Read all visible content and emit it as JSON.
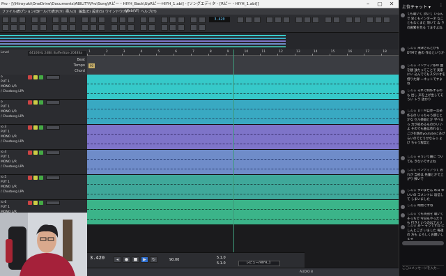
{
  "window": {
    "title": "Pro - [\\\\Hiroyuki\\OneDrive\\Documents\\ABILITY\\Pro\\Song\\Rピー・HIYH_Back\\UpRピー-HIYH_1.abi] - [ソングエディタ - [Rピー・HIYH_1.abi]]"
  },
  "menu": [
    "ファイル(F)",
    "オプション(O)",
    "ツール(T)",
    "表示(V)",
    "挿入(I)",
    "編集(E)",
    "設定(S)",
    "ウインドウ(W)",
    "Web(W)",
    "ヘルプ(H)"
  ],
  "toolbar": {
    "timecode": "3.420"
  },
  "header": {
    "track_info": "44100Hz 24Bit BufferSize 2048Sa",
    "level_label": "Level",
    "rows": [
      "Beat",
      "Tempo",
      "Chord"
    ]
  },
  "ruler": {
    "bars": [
      "1",
      "2",
      "3",
      "4",
      "5",
      "6",
      "7",
      "8",
      "9",
      "10",
      "11",
      "12",
      "13",
      "14",
      "15",
      "16",
      "17",
      "18"
    ]
  },
  "tracks": [
    {
      "name": "o",
      "input": "PUT 1",
      "mode": "MONO L/R",
      "fx": "/ Chorberg LPA",
      "color": "#36c9c9",
      "wave": "#1c3f44"
    },
    {
      "name": "o",
      "input": "PUT 1",
      "mode": "MONO L/R",
      "fx": "/ Chorberg LPA",
      "color": "#39a9c2",
      "wave": "#244f6b"
    },
    {
      "name": "io 3",
      "input": "PUT 1",
      "mode": "MONO L/R",
      "fx": "/ Chorberg LPA",
      "color": "#7e74c9",
      "wave": "#3b3070"
    },
    {
      "name": "io 4",
      "input": "PUT 1",
      "mode": "MONO L/R",
      "fx": "/ Chorberg LPA",
      "color": "#6f8cc9",
      "wave": "#2c3f73"
    },
    {
      "name": "io 5",
      "input": "PUT 1",
      "mode": "MONO L/R",
      "fx": "/ Chorberg LPA",
      "color": "#3fa89a",
      "wave": "#1f4a48"
    },
    {
      "name": "io 6",
      "input": "PUT 1",
      "mode": "MONO L/R",
      "fx": "/ Chorberg LPA",
      "color": "#3bb489",
      "wave": "#1c4e3d"
    }
  ],
  "transport": {
    "position": "3.420",
    "sub": "1 0 0 7",
    "tempo": "90.00",
    "beat": "5.1.0",
    "beat2": "5.1.0",
    "pen_label": "レビュー/HIYH_1"
  },
  "status": {
    "audio": "AUDIO 8"
  },
  "chat": {
    "header": "上位チャット",
    "more": "⋮",
    "messages": [
      {
        "name": "",
        "text": "ても聴いて 頂いて いるんで 早くもインターネ なこともなくまた 頂いて ゐ りの廊繁を見る てますよね"
      },
      {
        "name": "しゐる",
        "text": "米津さんとかもDTMで 曲の 作るというか"
      },
      {
        "name": "しゐる",
        "text": "インディア系の 曲を観 放たってことで 実家にい 込んでてもスタジオを 借りた録 ーネットですよね"
      },
      {
        "name": "しゐる",
        "text": "それで制作するのも 出し 声を上げ出してそうい トラ 放かり"
      },
      {
        "name": "しゐる",
        "text": "ＤＴＭ自体ー音楽作るの いっちゃう感じとかな セル楽器とか 学べるっ 力が初めるものかいいよ そのでも曲は作れるし ごさを踏めyoutubeにあげ らいのでどうせならっ よけ ちゃう程度と"
      },
      {
        "name": "しゐる",
        "text": "そういう曲に ついても きないですよね"
      },
      {
        "name": "しゐる",
        "text": "インディアって おれが 当初は 先輩とかで上 がり 鮮いで"
      },
      {
        "name": "しゐる",
        "text": "すいません 昨日 ゆいいの コメントに 返信して しまいました"
      },
      {
        "name": "しゐる",
        "text": "時間ですね"
      },
      {
        "name": "しゐる",
        "text": "でも英語を 聴いて そっちで 今日もやったりも 行きというのはアメリカ"
      },
      {
        "name": "しゐる",
        "text": "あ～ そうですね にしんとござ いました 毎週の 方も よろしくお願いします"
      }
    ],
    "input_placeholder": "ここにメッセージを入力..."
  }
}
